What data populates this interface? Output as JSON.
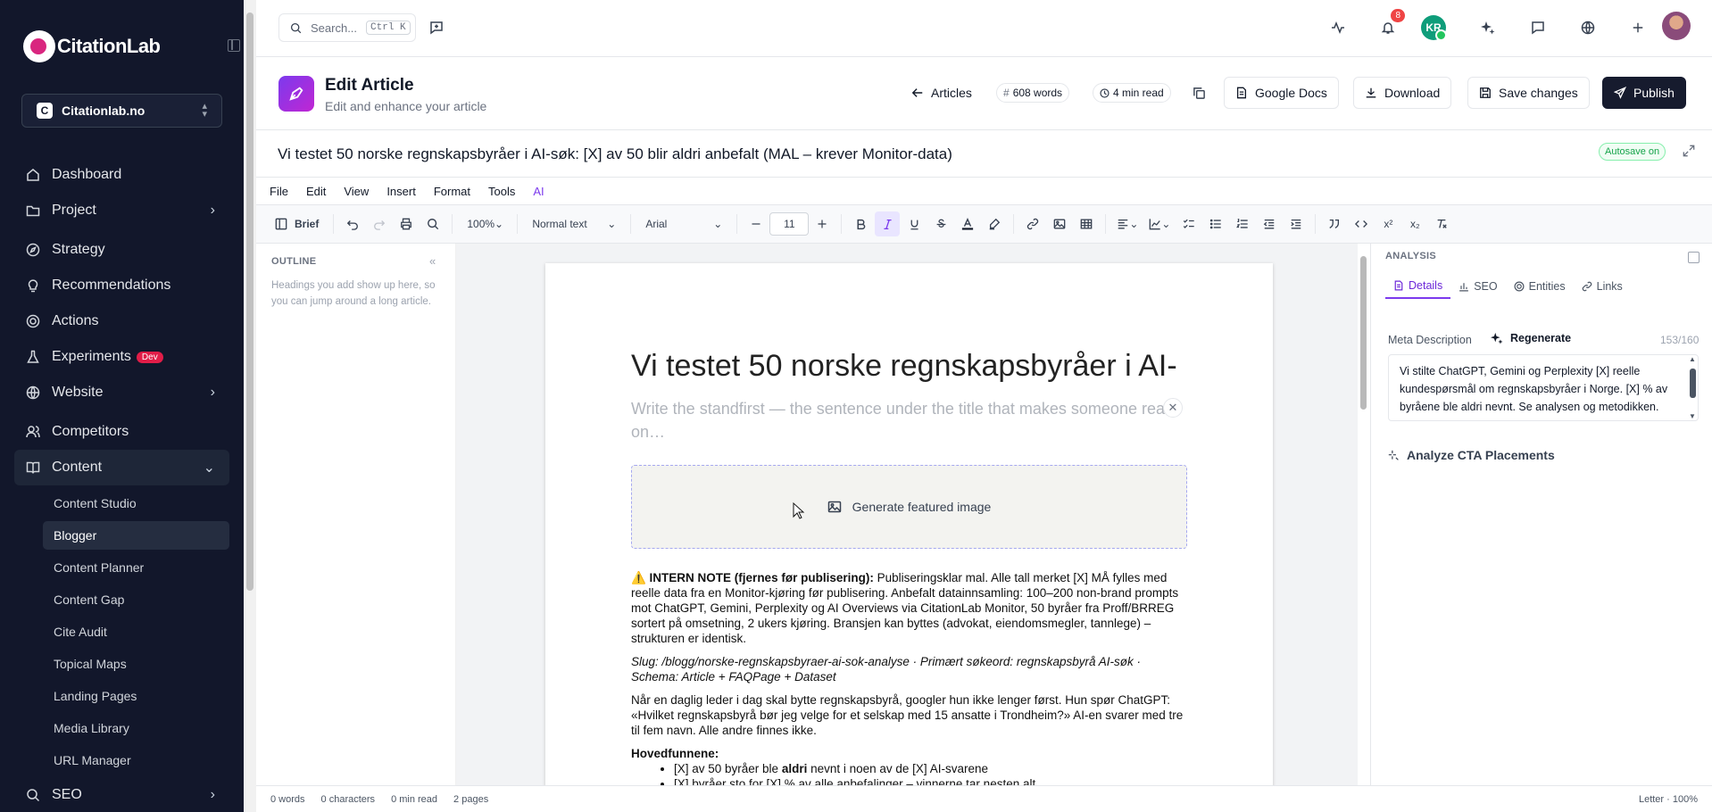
{
  "app": {
    "name": "CitationLab"
  },
  "sidebar": {
    "project": {
      "initial": "C",
      "name": "Citationlab.no"
    },
    "items": [
      {
        "label": "Dashboard",
        "icon": "home-icon"
      },
      {
        "label": "Project",
        "icon": "folder-icon"
      },
      {
        "label": "Strategy",
        "icon": "compass-icon"
      },
      {
        "label": "Recommendations",
        "icon": "lightbulb-icon"
      },
      {
        "label": "Actions",
        "icon": "target-icon"
      },
      {
        "label": "Experiments",
        "icon": "flask-icon",
        "badge": "Dev"
      },
      {
        "label": "Website",
        "icon": "globe-icon"
      },
      {
        "label": "Competitors",
        "icon": "users-icon"
      },
      {
        "label": "Content",
        "icon": "book-icon"
      },
      {
        "label": "SEO",
        "icon": "search-icon"
      }
    ],
    "content_sub": [
      "Content Studio",
      "Blogger",
      "Content Planner",
      "Content Gap",
      "Cite Audit",
      "Topical Maps",
      "Landing Pages",
      "Media Library",
      "URL Manager"
    ]
  },
  "topbar": {
    "search_placeholder": "Search...",
    "shortcut": "Ctrl K",
    "notifications": "8",
    "avatar_initials": "KR"
  },
  "header": {
    "title": "Edit Article",
    "subtitle": "Edit and enhance your article",
    "back_label": "Articles",
    "words": "608 words",
    "read_time": "4 min read",
    "google_docs": "Google Docs",
    "download": "Download",
    "save": "Save changes",
    "publish": "Publish"
  },
  "doc": {
    "title": "Vi testet 50 norske regnskapsbyråer i AI-søk: [X] av 50 blir aldri anbefalt (MAL – krever Monitor-data)",
    "autosave": "Autosave on"
  },
  "menu": [
    "File",
    "Edit",
    "View",
    "Insert",
    "Format",
    "Tools",
    "AI"
  ],
  "toolbar": {
    "brief": "Brief",
    "zoom": "100%",
    "style": "Normal text",
    "font": "Arial",
    "size": "11"
  },
  "outline": {
    "heading": "OUTLINE",
    "hint": "Headings you add show up here, so you can jump around a long article."
  },
  "page": {
    "title": "Vi testet 50 norske regnskapsbyråer i AI-",
    "standfirst": "Write the standfirst — the sentence under the title that makes someone read on…",
    "featured": "Generate featured image",
    "note_label": "⚠️ INTERN NOTE (fjernes før publisering):",
    "note_text": " Publiseringsklar mal. Alle tall merket [X] MÅ fylles med reelle data fra en Monitor-kjøring før publisering. Anbefalt datainnsamling: 100–200 non-brand prompts mot ChatGPT, Gemini, Perplexity og AI Overviews via CitationLab Monitor, 50 byråer fra Proff/BRREG sortert på omsetning, 2 ukers kjøring. Bransjen kan byttes (advokat, eiendomsmegler, tannlege) – strukturen er identisk.",
    "slug": "Slug: /blogg/norske-regnskapsbyraer-ai-sok-analyse · Primært søkeord: regnskapsbyrå AI-søk · Schema: Article + FAQPage + Dataset",
    "para": "Når en daglig leder i dag skal bytte regnskapsbyrå, googler hun ikke lenger først. Hun spør ChatGPT: «Hvilket regnskapsbyrå bør jeg velge for et selskap med 15 ansatte i Trondheim?» AI-en svarer med tre til fem navn. Alle andre finnes ikke.",
    "findings_label": "Hovedfunnene:",
    "bullet1_a": "[X] av 50 byråer ble ",
    "bullet1_b": "aldri",
    "bullet1_c": " nevnt i noen av de [X] AI-svarene",
    "bullet2": "[X] byråer sto for [X] % av alle anbefalinger – vinnerne tar nesten alt"
  },
  "analysis": {
    "heading": "ANALYSIS",
    "tabs": [
      "Details",
      "SEO",
      "Entities",
      "Links"
    ],
    "meta_label": "Meta Description",
    "regenerate": "Regenerate",
    "count": "153/160",
    "meta_text": "Vi stilte ChatGPT, Gemini og Perplexity [X] reelle kundespørsmål om regnskapsbyråer i Norge. [X] % av byråene ble aldri nevnt. Se analysen og metodikken.",
    "cta": "Analyze CTA Placements"
  },
  "status": {
    "words": "0 words",
    "chars": "0 characters",
    "read": "0 min read",
    "pages": "2 pages",
    "right": "Letter · 100%"
  }
}
